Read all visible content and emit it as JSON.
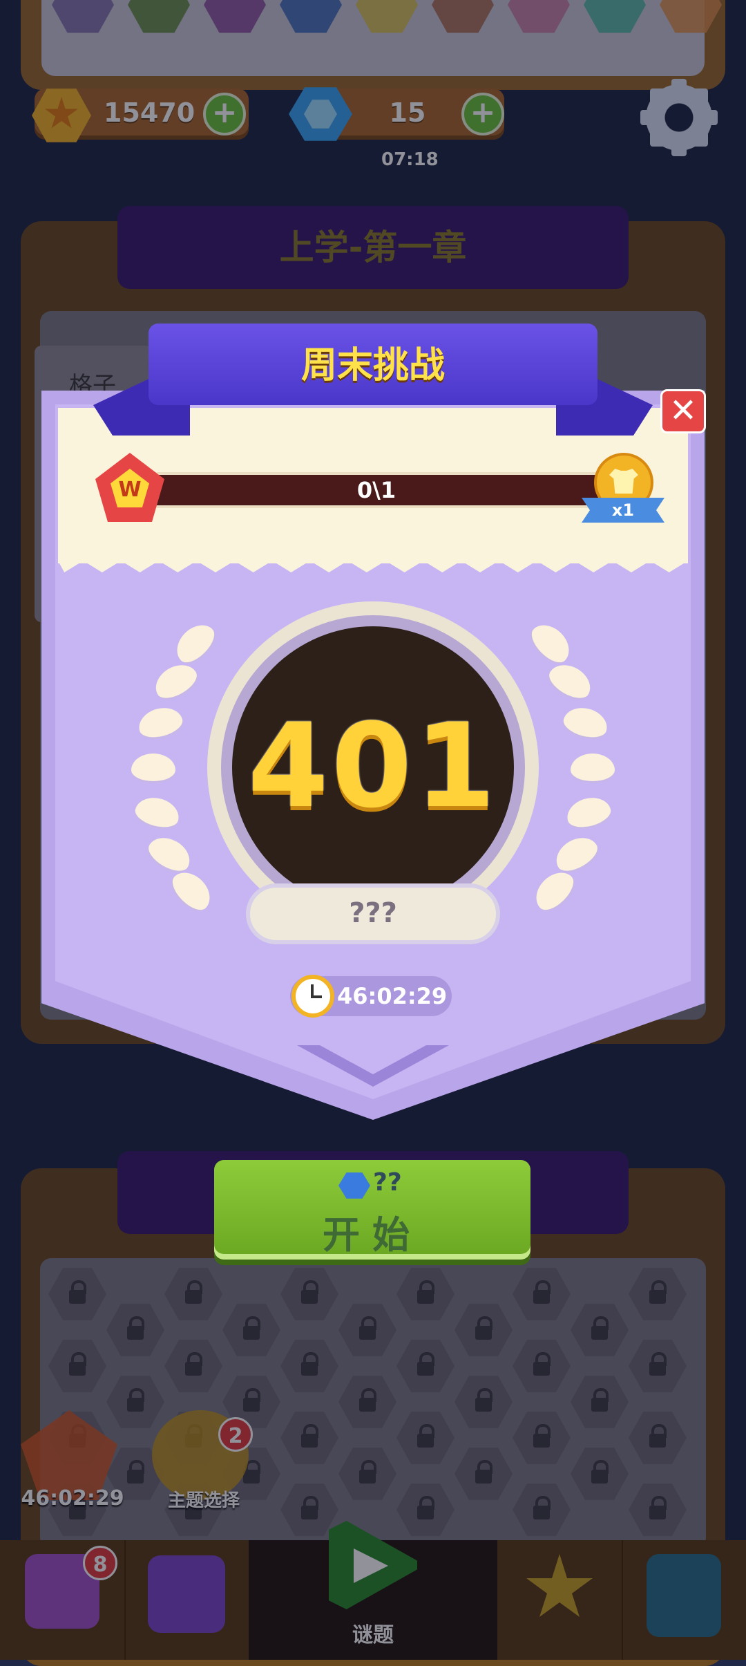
{
  "currency": {
    "coins": "15470",
    "gems": "15",
    "gem_timer": "07:18"
  },
  "chapter": {
    "title": "上学-第一章",
    "side_tab_label": "格子"
  },
  "modal": {
    "title": "周末挑战",
    "progress": "0\\1",
    "reward_multiplier": "x1",
    "level_number": "401",
    "level_name": "???",
    "countdown": "46:02:29"
  },
  "start_button": {
    "cost": "??",
    "label": "开始"
  },
  "side_buttons": {
    "weekly_event_timer": "46:02:29",
    "theme_label": "主题选择",
    "theme_badge": "2"
  },
  "bottom_nav": {
    "shop_badge": "8",
    "center_label": "谜题"
  },
  "colors": {
    "accent_purple": "#c6b5f2",
    "ribbon_blue": "#4a37c9",
    "title_yellow": "#ffe24a",
    "start_green": "#7ab92e",
    "close_red": "#e64545"
  },
  "icons": [
    "star-coin-icon",
    "gem-icon",
    "plus-icon",
    "gear-icon",
    "close-icon",
    "w-badge-icon",
    "shirt-reward-icon",
    "laurel-icon",
    "clock-icon",
    "lock-icon",
    "play-icon",
    "puzzle-icon",
    "book-icon",
    "shop-icon"
  ]
}
